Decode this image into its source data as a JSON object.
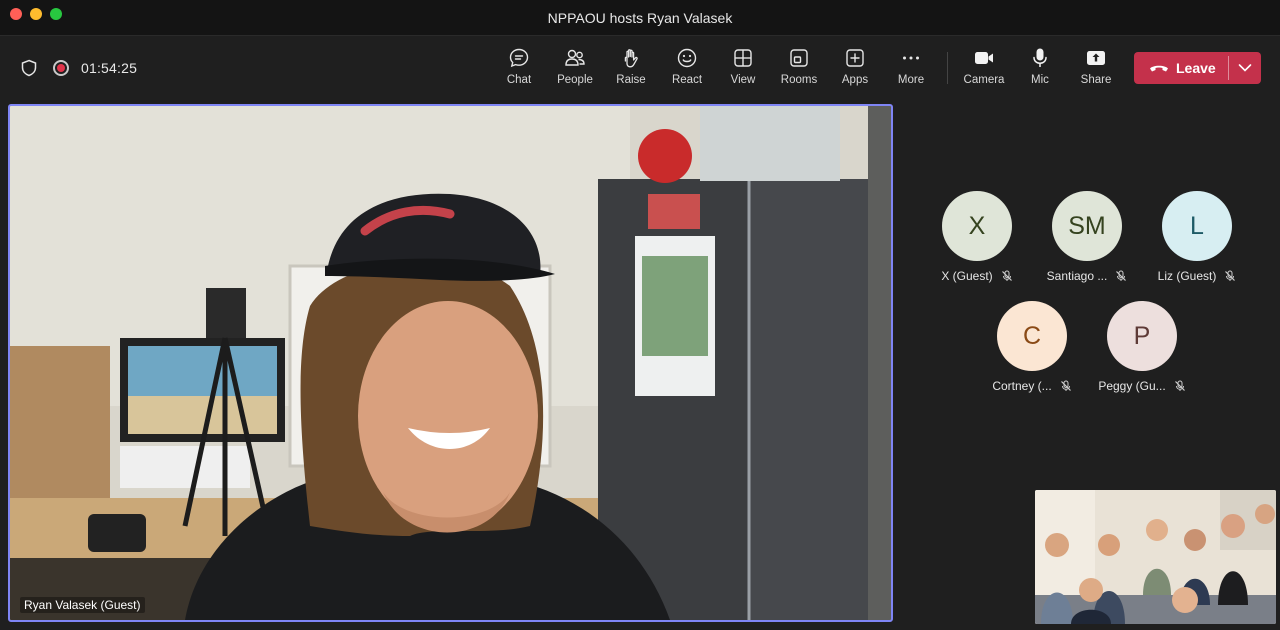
{
  "window": {
    "title": "NPPAOU hosts Ryan Valasek"
  },
  "meeting": {
    "timer": "01:54:25"
  },
  "toolbar": {
    "items": [
      {
        "label": "Chat",
        "icon": "chat-icon"
      },
      {
        "label": "People",
        "icon": "people-icon"
      },
      {
        "label": "Raise",
        "icon": "raise-hand-icon"
      },
      {
        "label": "React",
        "icon": "react-icon"
      },
      {
        "label": "View",
        "icon": "view-icon"
      },
      {
        "label": "Rooms",
        "icon": "rooms-icon"
      },
      {
        "label": "Apps",
        "icon": "apps-icon"
      },
      {
        "label": "More",
        "icon": "more-icon"
      },
      {
        "label": "Camera",
        "icon": "camera-icon"
      },
      {
        "label": "Mic",
        "icon": "mic-icon"
      },
      {
        "label": "Share",
        "icon": "share-icon"
      }
    ],
    "leave_label": "Leave"
  },
  "stage": {
    "speaker_name": "Ryan Valasek (Guest)",
    "active_border_color": "#7f85f5"
  },
  "participants": [
    {
      "initials": "X",
      "name": "X (Guest)",
      "avatar_bg": "#dfe5d8",
      "avatar_fg": "#35431f",
      "muted": true
    },
    {
      "initials": "SM",
      "name": "Santiago ...",
      "avatar_bg": "#dfe5d8",
      "avatar_fg": "#35431f",
      "muted": true
    },
    {
      "initials": "L",
      "name": "Liz (Guest)",
      "avatar_bg": "#d7eef2",
      "avatar_fg": "#1d5a66",
      "muted": true
    },
    {
      "initials": "C",
      "name": "Cortney (...",
      "avatar_bg": "#fbe6d3",
      "avatar_fg": "#8a4a16",
      "muted": true
    },
    {
      "initials": "P",
      "name": "Peggy (Gu...",
      "avatar_bg": "#eddfdd",
      "avatar_fg": "#5e3a36",
      "muted": true
    }
  ],
  "colors": {
    "leave": "#c4314b",
    "background": "#1f1f1f",
    "titlebar": "#141414"
  }
}
